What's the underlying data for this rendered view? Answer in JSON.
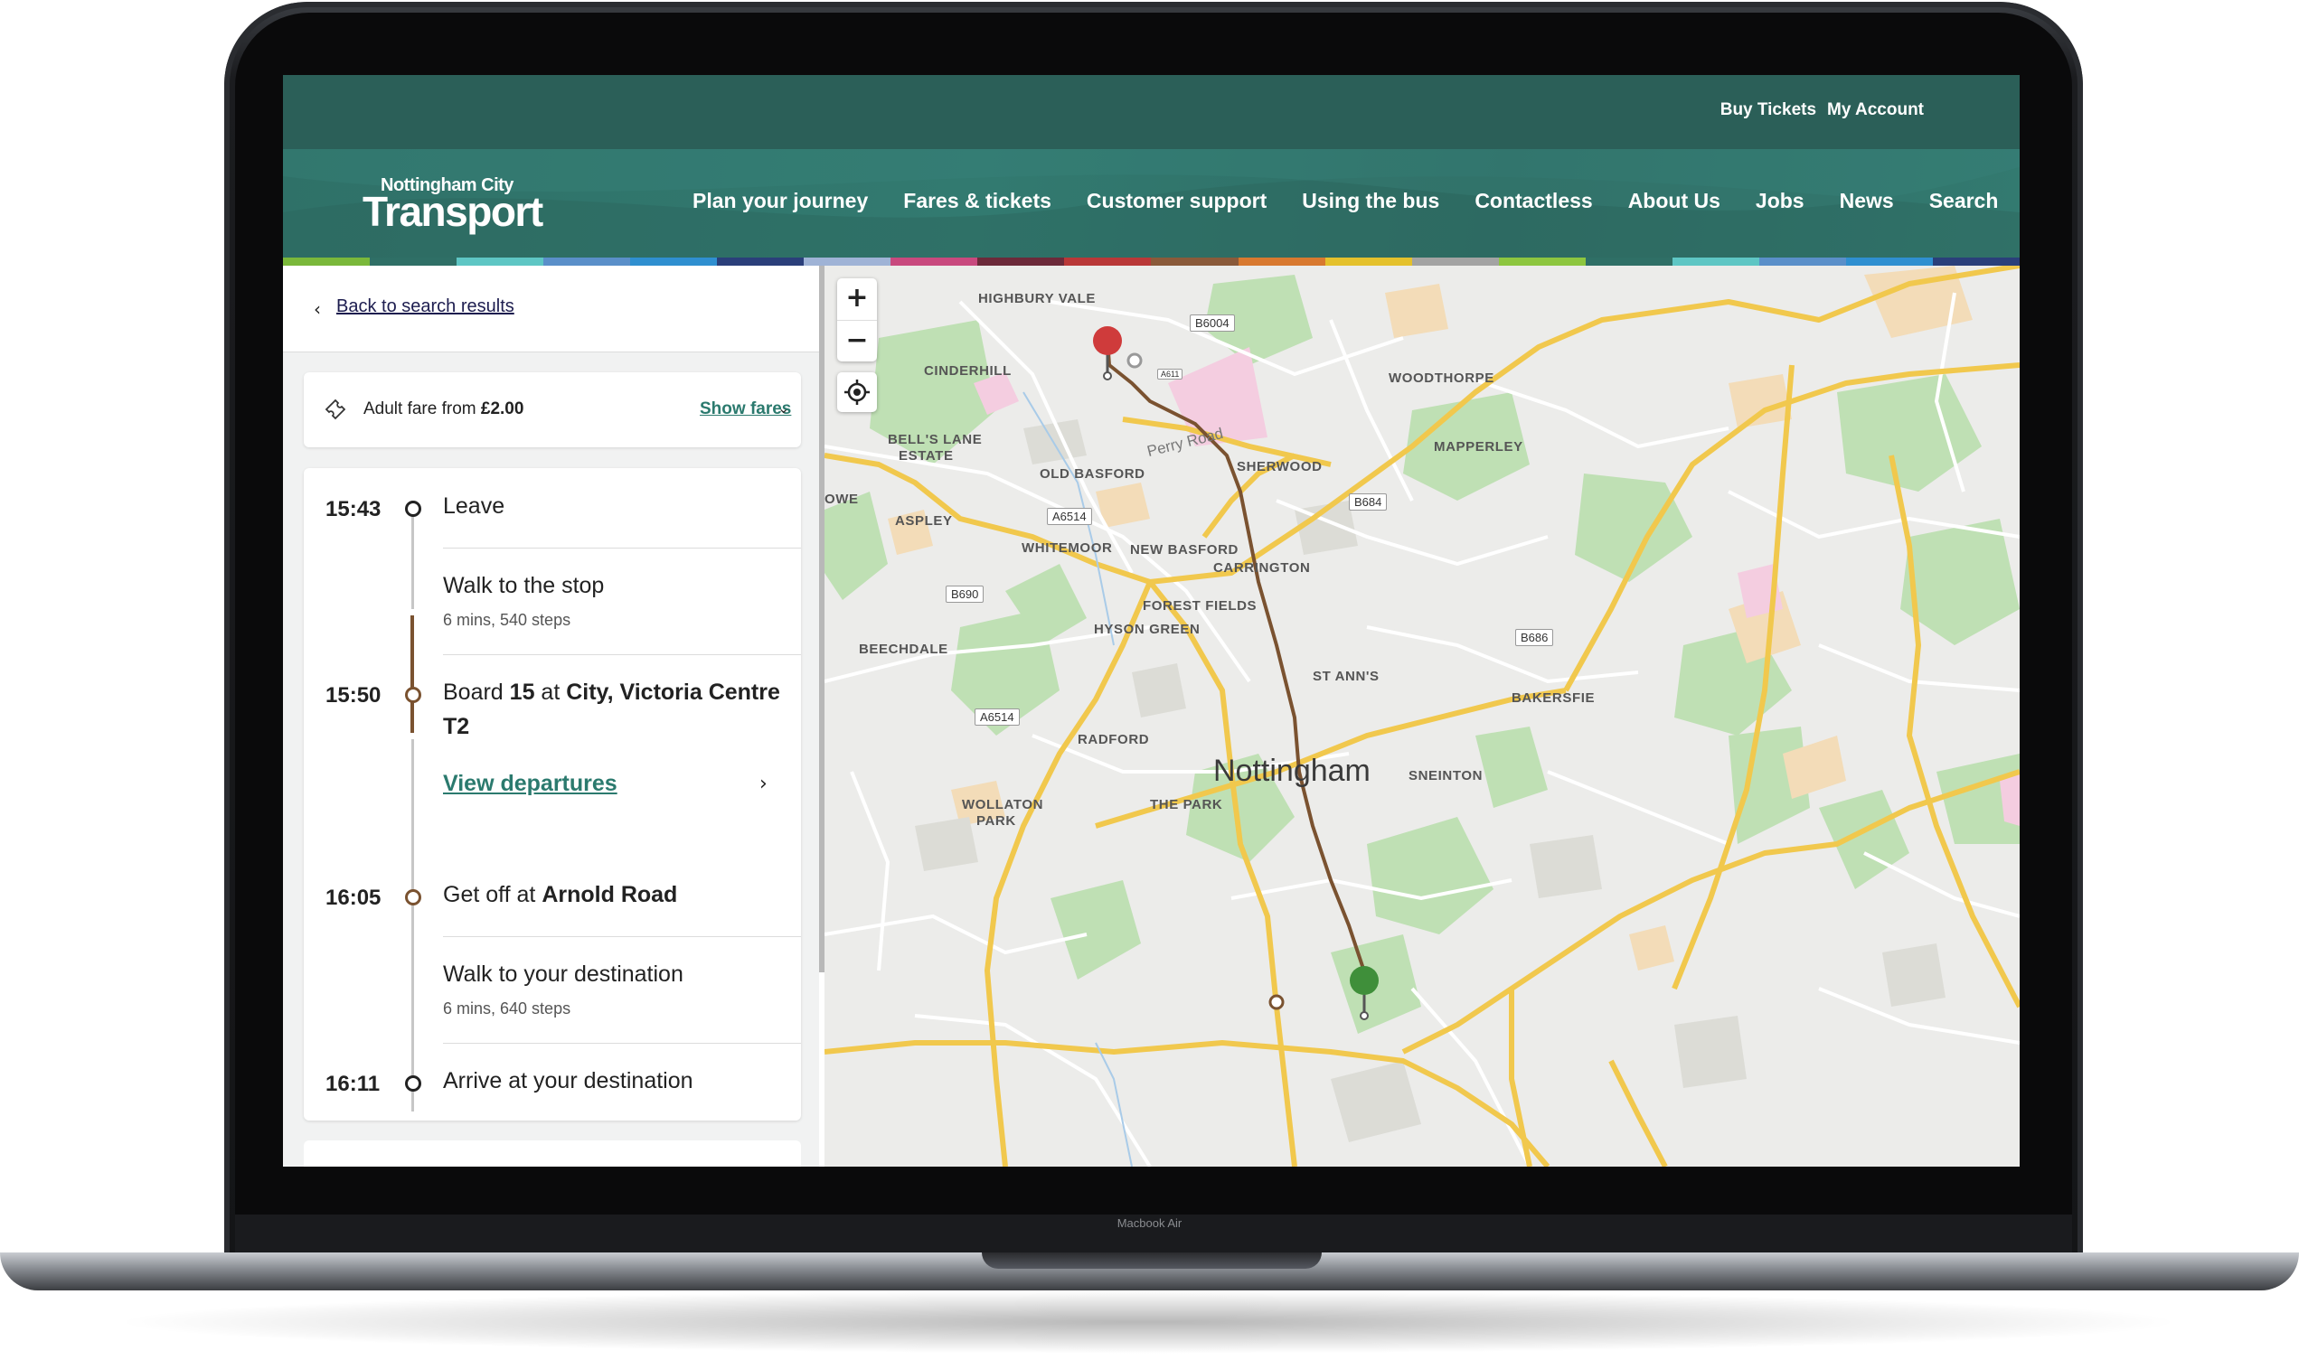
{
  "device": {
    "label": "Macbook Air"
  },
  "header": {
    "top_links": [
      "Buy Tickets",
      "My Account"
    ],
    "logo": {
      "line1": "Nottingham City",
      "line2": "Transport"
    },
    "nav": [
      "Plan your journey",
      "Fares & tickets",
      "Customer support",
      "Using the bus",
      "Contactless",
      "About Us",
      "Jobs",
      "News",
      "Search"
    ],
    "stripe_colors": [
      "#7ab83a",
      "#2f6f66",
      "#5ec6c4",
      "#5a8fc9",
      "#2f8fd0",
      "#2a3f7a",
      "#9fb3d6",
      "#c8497e",
      "#6c2a3a",
      "#b93838",
      "#8a5a3a",
      "#d8792f",
      "#e4c12c",
      "#a3a3a3",
      "#8dc63f",
      "#2f6f66",
      "#5ec6c4",
      "#5a8fc9",
      "#2f8fd0",
      "#2a3f7a"
    ]
  },
  "panel": {
    "back_link": "Back to search results",
    "fare": {
      "prefix": "Adult fare from ",
      "amount": "£2.00",
      "show": "Show fares"
    },
    "journey": {
      "leave_time": "15:43",
      "leave": "Leave",
      "walk1": "Walk to the stop",
      "walk1_sub": "6 mins, 540 steps",
      "board_time": "15:50",
      "board_pre": "Board ",
      "board_route": "15",
      "board_mid": " at ",
      "board_stop": "City, Victoria Centre T2",
      "view_departures": "View departures",
      "getoff_time": "16:05",
      "getoff_pre": "Get off at ",
      "getoff_stop": "Arnold Road",
      "walk2": "Walk to your destination",
      "walk2_sub": "6 mins, 640 steps",
      "arrive_time": "16:11",
      "arrive": "Arrive at your destination"
    }
  },
  "map": {
    "zoom_in": "+",
    "zoom_out": "−",
    "areas": [
      "HIGHBURY VALE",
      "CINDERHILL",
      "BELL'S LANE",
      "ESTATE",
      "OLD BASFORD",
      "ASPLEY",
      "WHITEMOOR",
      "NEW BASFORD",
      "CARRINGTON",
      "FOREST FIELDS",
      "HYSON GREEN",
      "BEECHDALE",
      "RADFORD",
      "WOLLATON",
      "PARK",
      "THE PARK",
      "SHERWOOD",
      "WOODTHORPE",
      "MAPPERLEY",
      "ST ANN'S",
      "BAKERSFIE",
      "SNEINTON",
      "OWE"
    ],
    "city": "Nottingham",
    "roads": [
      "B6004",
      "A6514",
      "B690",
      "A6514",
      "B684",
      "B686",
      "A611"
    ],
    "street": "Perry Road",
    "route_color": "#7a5230",
    "origin_color": "#cf3b3b",
    "destination_color": "#3f8f3a"
  }
}
